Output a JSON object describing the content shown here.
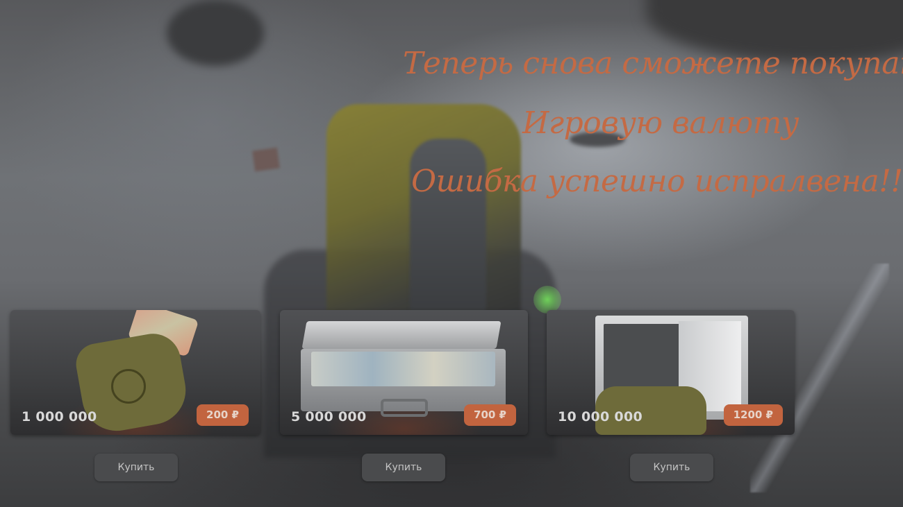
{
  "headline": {
    "line1": "Теперь снова сможете покупать",
    "line2": "Игровую валюту",
    "line3": "Ошибка успешно испралвена!!!"
  },
  "colors": {
    "headline": "#c46a44",
    "price_badge": "#c2643f",
    "button_bg": "#4a4b4d"
  },
  "products": [
    {
      "amount": "1 000 000",
      "price": "200 ₽",
      "buy_label": "Купить",
      "icon": "money-bag-icon"
    },
    {
      "amount": "5 000 000",
      "price": "700 ₽",
      "buy_label": "Купить",
      "icon": "briefcase-money-icon"
    },
    {
      "amount": "10 000 000",
      "price": "1200 ₽",
      "buy_label": "Купить",
      "icon": "safe-money-icon"
    }
  ]
}
